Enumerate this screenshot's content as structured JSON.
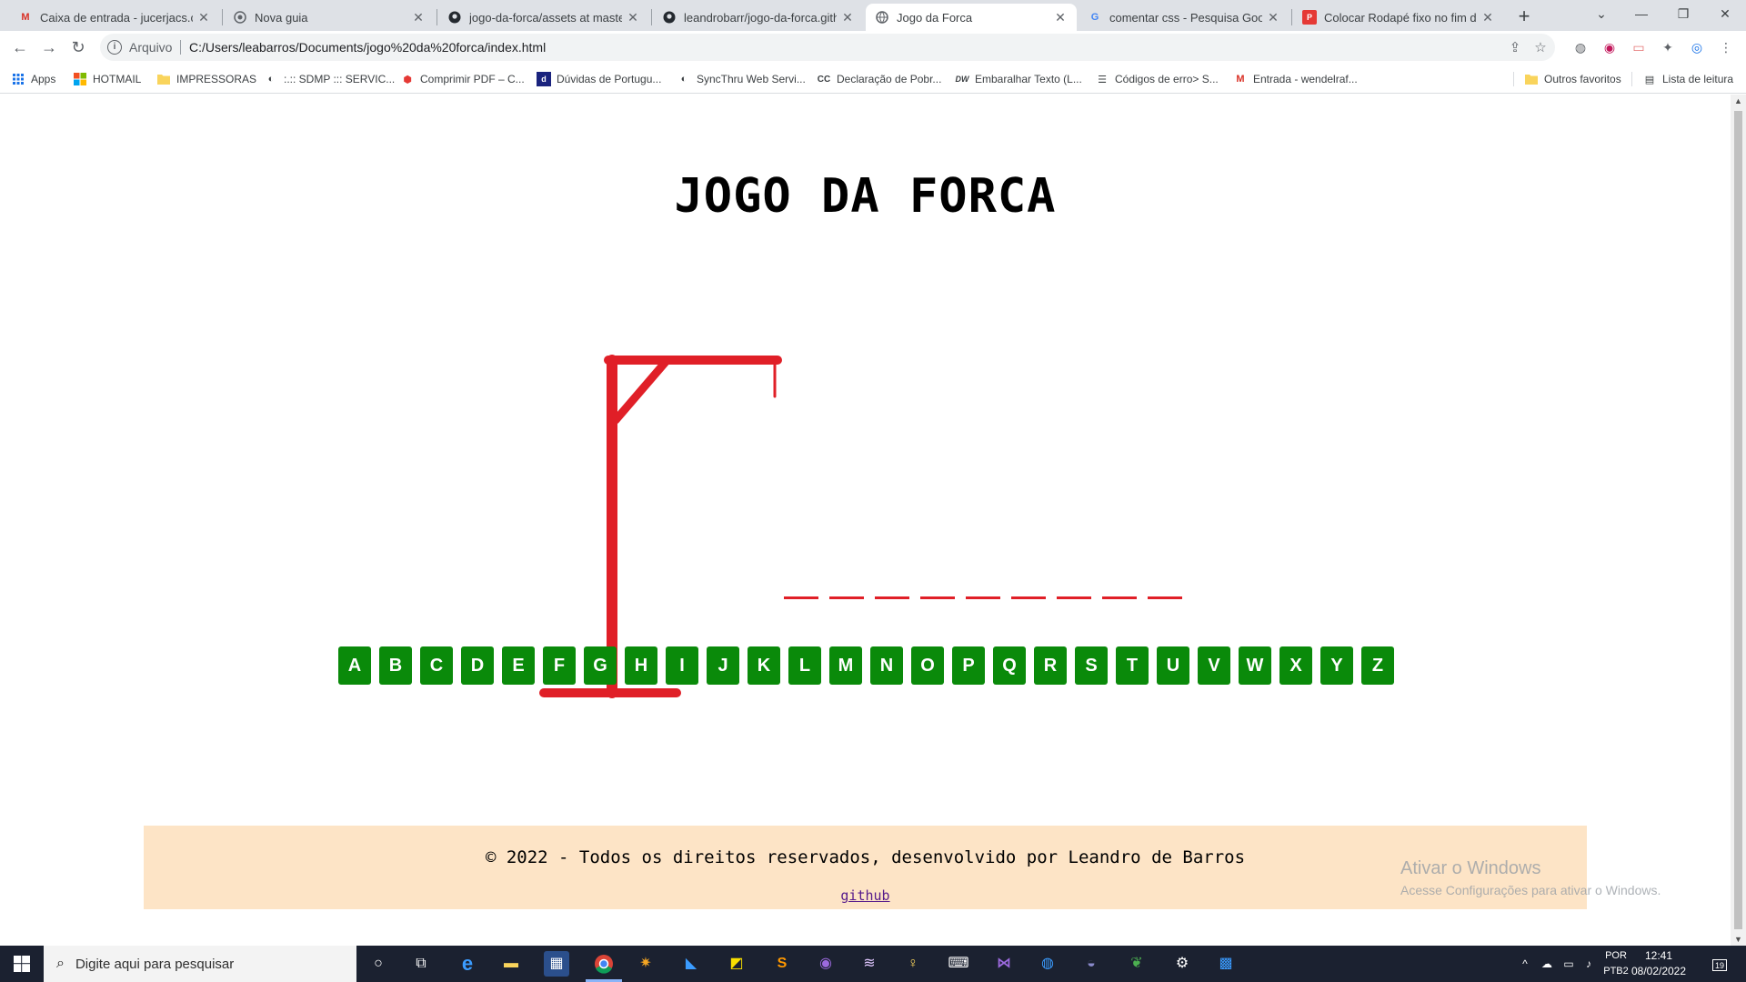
{
  "browser": {
    "tabs": [
      {
        "title": "Caixa de entrada - jucerjacs.cs@",
        "icon": "gmail-icon",
        "active": false
      },
      {
        "title": "Nova guia",
        "icon": "chrome-icon",
        "active": false
      },
      {
        "title": "jogo-da-forca/assets at master",
        "icon": "github-icon",
        "active": false
      },
      {
        "title": "leandrobarr/jogo-da-forca.githu",
        "icon": "github-icon",
        "active": false
      },
      {
        "title": "Jogo da Forca",
        "icon": "globe-icon",
        "active": true
      },
      {
        "title": "comentar css - Pesquisa Google",
        "icon": "google-icon",
        "active": false
      },
      {
        "title": "Colocar Rodapé fixo no fim da p",
        "icon": "page-icon",
        "active": false
      }
    ],
    "new_tab_label": "+",
    "address": {
      "scheme_label": "Arquivo",
      "url": "C:/Users/leabarros/Documents/jogo%20da%20forca/index.html"
    },
    "bookmarks": [
      {
        "label": "Apps",
        "icon": "apps-grid-icon"
      },
      {
        "label": "HOTMAIL",
        "icon": "microsoft-icon"
      },
      {
        "label": "IMPRESSORAS",
        "icon": "folder-icon"
      },
      {
        "label": ":.:: SDMP ::: SERVIC...",
        "icon": "globe-icon"
      },
      {
        "label": "Comprimir PDF – C...",
        "icon": "pdf-icon"
      },
      {
        "label": "Dúvidas de Portugu...",
        "icon": "book-icon"
      },
      {
        "label": "SyncThru Web Servi...",
        "icon": "globe-icon"
      },
      {
        "label": "Declaração de Pobr...",
        "icon": "cc-icon"
      },
      {
        "label": "Embaralhar Texto (L...",
        "icon": "dw-icon"
      },
      {
        "label": "Códigos de erro> S...",
        "icon": "list-icon"
      },
      {
        "label": "Entrada - wendelraf...",
        "icon": "gmail-icon"
      }
    ],
    "other_bookmarks": "Outros favoritos",
    "reading_list": "Lista de leitura"
  },
  "game": {
    "title": "JOGO DA FORCA",
    "word_slots": 9,
    "letters": [
      "A",
      "B",
      "C",
      "D",
      "E",
      "F",
      "G",
      "H",
      "I",
      "J",
      "K",
      "L",
      "M",
      "N",
      "O",
      "P",
      "Q",
      "R",
      "S",
      "T",
      "U",
      "V",
      "W",
      "X",
      "Y",
      "Z"
    ],
    "colors": {
      "gallows": "#e01f27",
      "key_bg": "#0a8a0a",
      "footer_bg": "#fde4c6"
    }
  },
  "footer": {
    "copyright": "© 2022 - Todos os direitos reservados, desenvolvido por Leandro de Barros",
    "github_link": "github"
  },
  "watermark": {
    "line1": "Ativar o Windows",
    "line2": "Acesse Configurações para ativar o Windows."
  },
  "taskbar": {
    "search_placeholder": "Digite aqui para pesquisar",
    "language": "POR",
    "keyboard": "PTB2",
    "time": "12:41",
    "date": "08/02/2022",
    "notifications": "19"
  }
}
